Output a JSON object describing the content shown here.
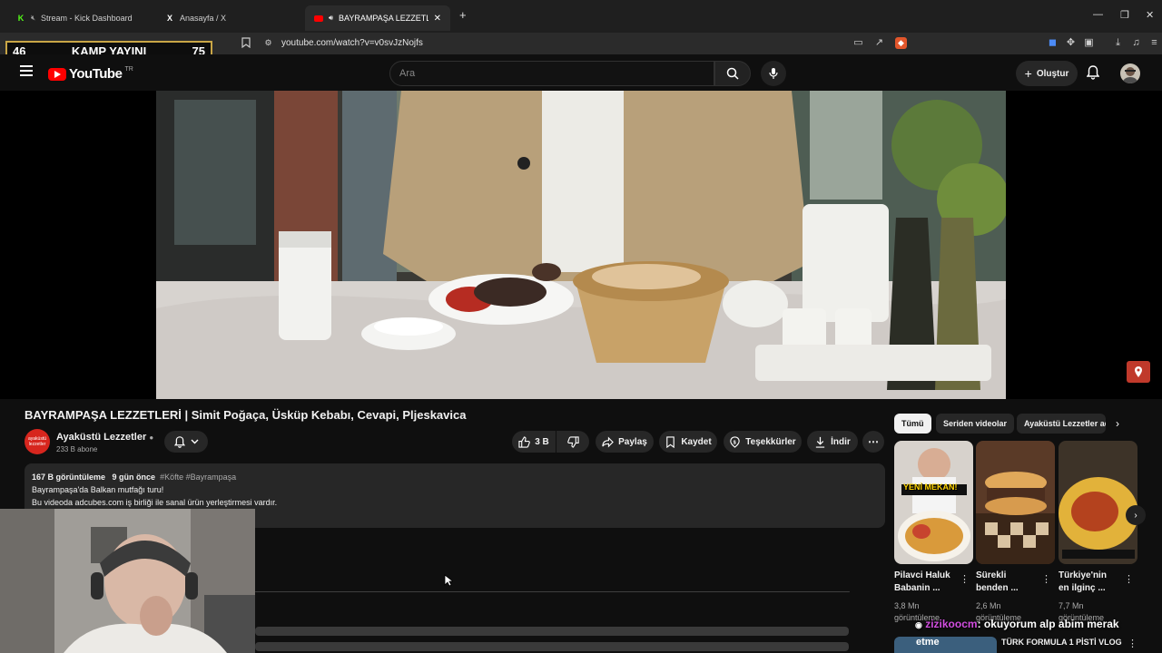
{
  "browser": {
    "tabs": [
      {
        "label": "Stream - Kick Dashboard",
        "icon": "kick-icon"
      },
      {
        "label": "Anasayfa / X",
        "icon": "x-icon"
      },
      {
        "label": "BAYRAMPAŞA LEZZETLERİ | Si",
        "icon": "youtube-icon",
        "active": true
      }
    ],
    "new_tab": "+",
    "url": "youtube.com/watch?v=v0svJzNojfs"
  },
  "overlay": {
    "left_number": "46",
    "label": "KAMP YAYINI",
    "right_number": "75"
  },
  "header": {
    "logo_text": "YouTube",
    "logo_country": "TR",
    "search_placeholder": "Ara",
    "create_label": "Oluştur"
  },
  "video": {
    "title": "BAYRAMPAŞA LEZZETLERİ | Simit Poğaça, Üsküp Kebabı, Cevapi, Pljeskavica"
  },
  "channel": {
    "avatar_text": "ayaküstü lezzetler",
    "name": "Ayaküstü Lezzetler",
    "subscribers": "233 B abone"
  },
  "actions": {
    "likes": "3 B",
    "share": "Paylaş",
    "save": "Kaydet",
    "thanks": "Teşekkürler",
    "download": "İndir"
  },
  "description": {
    "views": "167 B görüntüleme",
    "age": "9 gün önce",
    "tags": "#Köfte #Bayrampaşa",
    "line1": "Bayrampaşa'da Balkan mutfağı turu!",
    "line2": "Bu videoda adcubes.com iş birliği ile sanal ürün yerleştirmesi vardır."
  },
  "sidebar": {
    "chips": [
      "Tümü",
      "Seriden videolar",
      "Ayaküstü Lezzetler ad"
    ],
    "shorts": [
      {
        "title1": "Pilavci Haluk",
        "title2": "Babanin ...",
        "views1": "3,8 Mn",
        "views2": "görüntüleme",
        "badge": "YENİ MEKAN!"
      },
      {
        "title1": "Sürekli",
        "title2": "benden ...",
        "views1": "2,6 Mn",
        "views2": "görüntüleme",
        "badge": ""
      },
      {
        "title1": "Türkiye'nin",
        "title2": "en ilginç ...",
        "views1": "7,7 Mn",
        "views2": "görüntüleme",
        "badge": ""
      }
    ],
    "next_video_title": "TÜRK FORMULA 1 PİSTİ VLOG",
    "next_video_thumb_text": "etme"
  },
  "chat": {
    "user": "zizikoocm",
    "message": ": okuyorum alp abim merak"
  },
  "colors": {
    "youtube_red": "#ff0000",
    "kick_green": "#53fc18",
    "overlay_border": "#c9a646",
    "chat_user": "#d24ee0"
  }
}
